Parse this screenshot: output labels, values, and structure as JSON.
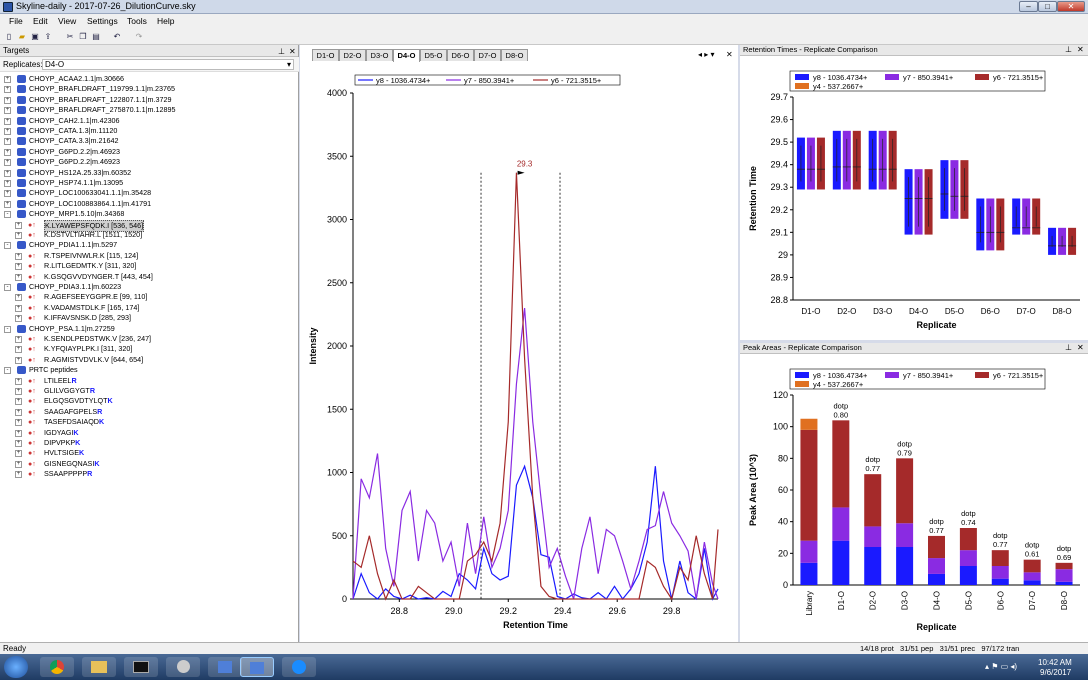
{
  "app": {
    "title": "Skyline-daily - 2017-07-26_DilutionCurve.sky",
    "status_left": "Ready",
    "status_right": "14/18 prot   31/51 pep   31/51 prec   97/172 tran"
  },
  "menu": [
    "File",
    "Edit",
    "View",
    "Settings",
    "Tools",
    "Help"
  ],
  "targets": {
    "header": "Targets",
    "replicates_label": "Replicates:",
    "replicate_value": "D4-O",
    "rows": [
      {
        "d": 0,
        "k": "prot",
        "t": "CHOYP_ACAA2.1.1|m.30666",
        "e": "+"
      },
      {
        "d": 0,
        "k": "prot",
        "t": "CHOYP_BRAFLDRAFT_119799.1.1|m.23765",
        "e": "+"
      },
      {
        "d": 0,
        "k": "prot",
        "t": "CHOYP_BRAFLDRAFT_122807.1.1|m.3729",
        "e": "+"
      },
      {
        "d": 0,
        "k": "prot",
        "t": "CHOYP_BRAFLDRAFT_275870.1.1|m.12895",
        "e": "+"
      },
      {
        "d": 0,
        "k": "prot",
        "t": "CHOYP_CAH2.1.1|m.42306",
        "e": "+"
      },
      {
        "d": 0,
        "k": "prot",
        "t": "CHOYP_CATA.1.3|m.11120",
        "e": "+"
      },
      {
        "d": 0,
        "k": "prot",
        "t": "CHOYP_CATA.3.3|m.21642",
        "e": "+"
      },
      {
        "d": 0,
        "k": "prot",
        "t": "CHOYP_G6PD.2.2|m.46923",
        "e": "+"
      },
      {
        "d": 0,
        "k": "prot",
        "t": "CHOYP_G6PD.2.2|m.46923",
        "e": "+"
      },
      {
        "d": 0,
        "k": "prot",
        "t": "CHOYP_HS12A.25.33|m.60352",
        "e": "+"
      },
      {
        "d": 0,
        "k": "prot",
        "t": "CHOYP_HSP74.1.1|m.13095",
        "e": "+"
      },
      {
        "d": 0,
        "k": "prot",
        "t": "CHOYP_LOC100633041.1.1|m.35428",
        "e": "+"
      },
      {
        "d": 0,
        "k": "prot",
        "t": "CHOYP_LOC100883864.1.1|m.41791",
        "e": "+"
      },
      {
        "d": 0,
        "k": "prot",
        "t": "CHOYP_MRP1.5.10|m.34368",
        "e": "-"
      },
      {
        "d": 1,
        "k": "pep",
        "t": "K.LYAWEPSFQDK.I [536, 546]",
        "e": "+",
        "sel": true
      },
      {
        "d": 1,
        "k": "pep",
        "t": "K.DSTVLTIAHR.L [1511, 1520]",
        "e": "+"
      },
      {
        "d": 0,
        "k": "prot",
        "t": "CHOYP_PDIA1.1.1|m.5297",
        "e": "-"
      },
      {
        "d": 1,
        "k": "pep",
        "t": "R.TSPEIVNWLR.K [115, 124]",
        "e": "+"
      },
      {
        "d": 1,
        "k": "pep",
        "t": "R.LITLGEDMTK.Y [311, 320]",
        "e": "+"
      },
      {
        "d": 1,
        "k": "pep",
        "t": "K.GSQGVVDYNGER.T [443, 454]",
        "e": "+"
      },
      {
        "d": 0,
        "k": "prot",
        "t": "CHOYP_PDIA3.1.1|m.60223",
        "e": "-"
      },
      {
        "d": 1,
        "k": "pep",
        "t": "R.AGEFSEEYGGPR.E [99, 110]",
        "e": "+"
      },
      {
        "d": 1,
        "k": "pep",
        "t": "K.VADAMSTDLK.F [165, 174]",
        "e": "+"
      },
      {
        "d": 1,
        "k": "pep",
        "t": "K.IFFAVSNSK.D [285, 293]",
        "e": "+"
      },
      {
        "d": 0,
        "k": "prot",
        "t": "CHOYP_PSA.1.1|m.27259",
        "e": "-"
      },
      {
        "d": 1,
        "k": "pep",
        "t": "K.SENDLPEDSTWK.V [236, 247]",
        "e": "+"
      },
      {
        "d": 1,
        "k": "pep",
        "t": "K.YFQIAYPLPK.I [311, 320]",
        "e": "+"
      },
      {
        "d": 1,
        "k": "pep",
        "t": "R.AGMISTVDVLK.V [644, 654]",
        "e": "+"
      },
      {
        "d": 0,
        "k": "prot",
        "t": "PRTC peptides",
        "e": "-"
      },
      {
        "d": 1,
        "k": "pep",
        "t": "LTILEEL",
        "h": "R",
        "e": "+"
      },
      {
        "d": 1,
        "k": "pep",
        "t": "GLILVGGYGT",
        "h": "R",
        "e": "+"
      },
      {
        "d": 1,
        "k": "pep",
        "t": "ELGQSGVDTYLQT",
        "h": "K",
        "e": "+"
      },
      {
        "d": 1,
        "k": "pep",
        "t": "SAAGAFGPELS",
        "h": "R",
        "e": "+"
      },
      {
        "d": 1,
        "k": "pep",
        "t": "TASEFDSAIAQD",
        "h": "K",
        "e": "+"
      },
      {
        "d": 1,
        "k": "pep",
        "t": "IGDYAGI",
        "h": "K",
        "e": "+"
      },
      {
        "d": 1,
        "k": "pep",
        "t": "DIPVPKP",
        "h": "K",
        "e": "+"
      },
      {
        "d": 1,
        "k": "pep",
        "t": "HVLTSIGE",
        "h": "K",
        "e": "+"
      },
      {
        "d": 1,
        "k": "pep",
        "t": "GISNEGQNASI",
        "h": "K",
        "e": "+"
      },
      {
        "d": 1,
        "k": "pep",
        "t": "SSAAPPPPP",
        "h": "R",
        "e": "+"
      }
    ]
  },
  "tabs": {
    "items": [
      "D1-O",
      "D2-O",
      "D3-O",
      "D4-O",
      "D5-O",
      "D6-O",
      "D7-O",
      "D8-O"
    ],
    "active": 3
  },
  "colors": {
    "y8": "#1a1aff",
    "y7": "#8a2be2",
    "y6": "#a52a2a",
    "y4": "#e07020"
  },
  "legend": {
    "y8": "y8 - 1036.4734+",
    "y7": "y7 - 850.3941+",
    "y6": "y6 - 721.3515+",
    "y4": "y4 - 537.2667+"
  },
  "chart_data": [
    {
      "type": "line",
      "xlabel": "Retention Time",
      "ylabel": "Intensity",
      "xlim": [
        28.63,
        29.97
      ],
      "ylim": [
        0,
        4000
      ],
      "xticks": [
        28.8,
        29.0,
        29.2,
        29.4,
        29.6,
        29.8
      ],
      "yticks": [
        0,
        500,
        1000,
        1500,
        2000,
        2500,
        3000,
        3500,
        4000
      ],
      "boundaries": [
        29.1,
        29.39
      ],
      "apex_label": "29.3",
      "apex_x": 29.26,
      "series": [
        {
          "name": "y8 - 1036.4734+",
          "key": "y8",
          "x": [
            28.63,
            28.66,
            28.69,
            28.72,
            28.75,
            28.78,
            28.81,
            28.84,
            28.87,
            28.9,
            28.93,
            28.96,
            28.99,
            29.02,
            29.05,
            29.08,
            29.11,
            29.14,
            29.17,
            29.2,
            29.23,
            29.26,
            29.29,
            29.32,
            29.35,
            29.38,
            29.41,
            29.44,
            29.47,
            29.5,
            29.53,
            29.56,
            29.59,
            29.62,
            29.65,
            29.68,
            29.71,
            29.74,
            29.77,
            29.8,
            29.83,
            29.86,
            29.89,
            29.92,
            29.95,
            29.97
          ],
          "y": [
            0,
            200,
            50,
            0,
            80,
            20,
            0,
            30,
            0,
            10,
            0,
            60,
            20,
            200,
            150,
            80,
            400,
            200,
            150,
            180,
            900,
            1050,
            800,
            350,
            330,
            20,
            0,
            40,
            10,
            0,
            50,
            0,
            100,
            0,
            80,
            200,
            450,
            1050,
            300,
            0,
            300,
            50,
            0,
            400,
            0,
            80
          ]
        },
        {
          "name": "y7 - 850.3941+",
          "key": "y7",
          "x": [
            28.63,
            28.66,
            28.69,
            28.72,
            28.75,
            28.78,
            28.81,
            28.84,
            28.87,
            28.9,
            28.93,
            28.96,
            28.99,
            29.02,
            29.05,
            29.08,
            29.11,
            29.14,
            29.17,
            29.2,
            29.23,
            29.26,
            29.29,
            29.32,
            29.35,
            29.38,
            29.41,
            29.44,
            29.47,
            29.5,
            29.53,
            29.56,
            29.59,
            29.62,
            29.65,
            29.68,
            29.71,
            29.74,
            29.77,
            29.8,
            29.83,
            29.86,
            29.89,
            29.92,
            29.95,
            29.97
          ],
          "y": [
            0,
            950,
            800,
            1150,
            400,
            100,
            700,
            850,
            300,
            700,
            600,
            300,
            450,
            100,
            600,
            200,
            650,
            250,
            400,
            700,
            1700,
            2300,
            1400,
            800,
            250,
            400,
            180,
            0,
            400,
            650,
            200,
            550,
            500,
            300,
            80,
            300,
            550,
            580,
            850,
            600,
            500,
            380,
            0,
            450,
            120,
            0
          ]
        },
        {
          "name": "y6 - 721.3515+",
          "key": "y6",
          "x": [
            28.63,
            28.66,
            28.69,
            28.72,
            28.75,
            28.78,
            28.81,
            28.84,
            28.87,
            28.9,
            28.93,
            28.96,
            28.99,
            29.02,
            29.05,
            29.08,
            29.11,
            29.14,
            29.17,
            29.2,
            29.23,
            29.26,
            29.29,
            29.32,
            29.35,
            29.38,
            29.41,
            29.44,
            29.47,
            29.5,
            29.53,
            29.56,
            29.59,
            29.62,
            29.65,
            29.68,
            29.71,
            29.74,
            29.77,
            29.8,
            29.83,
            29.86,
            29.89,
            29.92,
            29.95,
            29.97
          ],
          "y": [
            300,
            250,
            500,
            200,
            0,
            150,
            0,
            0,
            100,
            50,
            0,
            0,
            0,
            0,
            300,
            350,
            450,
            300,
            600,
            1400,
            3370,
            1900,
            800,
            100,
            20,
            0,
            0,
            0,
            0,
            0,
            0,
            0,
            0,
            0,
            0,
            0,
            300,
            250,
            100,
            0,
            250,
            150,
            500,
            200,
            0,
            550
          ]
        }
      ]
    },
    {
      "type": "box",
      "title": "Retention Times - Replicate Comparison",
      "xlabel": "Replicate",
      "ylabel": "Retention Time",
      "ylim": [
        28.8,
        29.7
      ],
      "yticks": [
        28.8,
        28.9,
        29.0,
        29.1,
        29.2,
        29.3,
        29.4,
        29.5,
        29.6,
        29.7
      ],
      "categories": [
        "D1-O",
        "D2-O",
        "D3-O",
        "D4-O",
        "D5-O",
        "D6-O",
        "D7-O",
        "D8-O"
      ],
      "series": [
        {
          "name": "y8 - 1036.4734+",
          "key": "y8",
          "low": [
            29.29,
            29.29,
            29.29,
            29.09,
            29.16,
            29.02,
            29.09,
            29.0
          ],
          "high": [
            29.52,
            29.55,
            29.55,
            29.38,
            29.42,
            29.25,
            29.25,
            29.12
          ],
          "mid": [
            29.38,
            29.39,
            29.38,
            29.25,
            29.27,
            29.1,
            29.12,
            29.04
          ]
        },
        {
          "name": "y7 - 850.3941+",
          "key": "y7",
          "low": [
            29.29,
            29.29,
            29.29,
            29.09,
            29.16,
            29.02,
            29.09,
            29.0
          ],
          "high": [
            29.52,
            29.55,
            29.55,
            29.38,
            29.42,
            29.25,
            29.25,
            29.12
          ],
          "mid": [
            29.38,
            29.39,
            29.38,
            29.25,
            29.26,
            29.1,
            29.12,
            29.04
          ]
        },
        {
          "name": "y6 - 721.3515+",
          "key": "y6",
          "low": [
            29.29,
            29.29,
            29.29,
            29.09,
            29.16,
            29.02,
            29.09,
            29.0
          ],
          "high": [
            29.52,
            29.55,
            29.55,
            29.38,
            29.42,
            29.25,
            29.25,
            29.12
          ],
          "mid": [
            29.38,
            29.39,
            29.38,
            29.25,
            29.26,
            29.1,
            29.12,
            29.04
          ]
        }
      ],
      "legend": [
        "y8 - 1036.4734+",
        "y7 - 850.3941+",
        "y6 - 721.3515+",
        "y4 - 537.2667+"
      ]
    },
    {
      "type": "bar",
      "title": "Peak Areas - Replicate Comparison",
      "xlabel": "Replicate",
      "ylabel": "Peak Area (10^3)",
      "ylim": [
        0,
        120
      ],
      "yticks": [
        0,
        20,
        40,
        60,
        80,
        100,
        120
      ],
      "categories": [
        "Library",
        "D1-O",
        "D2-O",
        "D3-O",
        "D4-O",
        "D5-O",
        "D6-O",
        "D7-O",
        "D8-O"
      ],
      "series": [
        {
          "name": "y8 - 1036.4734+",
          "key": "y8",
          "values": [
            14,
            28,
            24,
            24,
            7,
            12,
            4,
            3,
            2
          ]
        },
        {
          "name": "y7 - 850.3941+",
          "key": "y7",
          "values": [
            14,
            21,
            13,
            15,
            10,
            10,
            8,
            5,
            8
          ]
        },
        {
          "name": "y6 - 721.3515+",
          "key": "y6",
          "values": [
            70,
            55,
            33,
            41,
            14,
            14,
            10,
            8,
            4
          ]
        },
        {
          "name": "y4 - 537.2667+",
          "key": "y4",
          "values": [
            7,
            0,
            0,
            0,
            0,
            0,
            0,
            0,
            0
          ]
        }
      ],
      "dotp": [
        "",
        "0.80",
        "0.77",
        "0.79",
        "0.77",
        "0.74",
        "0.77",
        "0.61",
        "0.69"
      ],
      "dotp_label": "dotp",
      "legend": [
        "y8 - 1036.4734+",
        "y7 - 850.3941+",
        "y6 - 721.3515+",
        "y4 - 537.2667+"
      ]
    }
  ],
  "clock": {
    "time": "10:42 AM",
    "date": "9/6/2017"
  }
}
